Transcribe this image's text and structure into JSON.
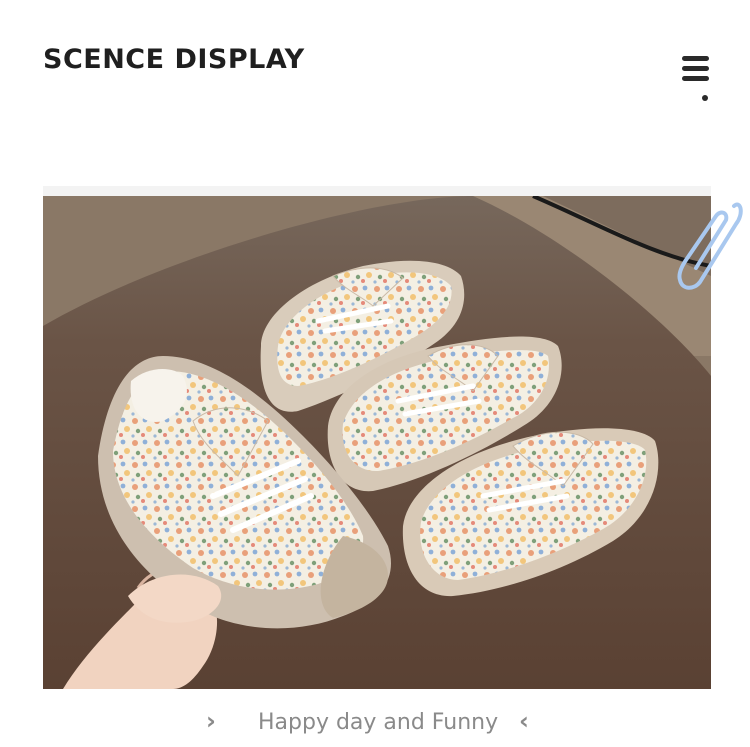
{
  "header": {
    "title": "SCENCE DISPLAY",
    "menu_icon": "menu-icon"
  },
  "gallery": {
    "image_alt": "floral canvas toddler shoes",
    "decoration_icon": "paperclip-icon",
    "caption": "Happy day and Funny",
    "prev_icon": "chevron-right-icon",
    "next_icon": "chevron-left-icon"
  },
  "colors": {
    "title": "#1f1f1f",
    "caption": "#8a8a8a",
    "clip": "#a9c8ef"
  }
}
